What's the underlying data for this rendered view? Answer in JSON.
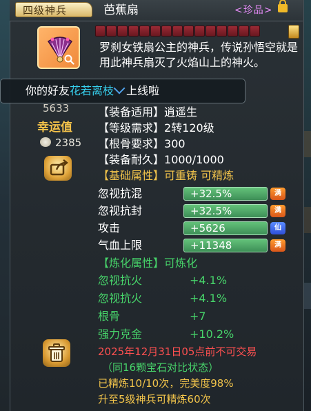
{
  "header": {
    "rank_tab": "四级神兵",
    "item_name": "芭蕉扇",
    "rarity": "<珍品>"
  },
  "description": "罗刹女铁扇公主的神兵，传说孙悟空就是用此神兵扇灭了火焰山上的神火。",
  "toast": {
    "prefix": "你的好友",
    "friend": "花若离枝",
    "suffix": "上线啦"
  },
  "left": {
    "score": "5633",
    "luck_label": "幸运值",
    "coin_value": "2385"
  },
  "base_rows": [
    {
      "label": "【装备适用】",
      "value": "逍遥生"
    },
    {
      "label": "【等级需求】",
      "value": "2转120级"
    },
    {
      "label": "【根骨要求】",
      "value": "300"
    },
    {
      "label": "【装备耐久】",
      "value": "1000/1000"
    }
  ],
  "base_attr": {
    "label": "【基础属性】",
    "value": "可重铸  可精炼"
  },
  "base_stats": [
    {
      "label": "忽视抗混",
      "value": "+32.5%",
      "badge": "满",
      "badge_color": "#e8742a"
    },
    {
      "label": "忽视抗封",
      "value": "+32.5%",
      "badge": "满",
      "badge_color": "#e8742a"
    },
    {
      "label": "攻击",
      "value": "+5626",
      "badge": "仙",
      "badge_color": "#3d62ee"
    },
    {
      "label": "气血上限",
      "value": "+11348",
      "badge": "满",
      "badge_color": "#e8742a"
    }
  ],
  "refine_attr": {
    "label": "【炼化属性】",
    "value": "可炼化"
  },
  "refine_stats": [
    {
      "label": "忽视抗火",
      "value": "+4.1%"
    },
    {
      "label": "忽视抗火",
      "value": "+4.1%"
    },
    {
      "label": "根骨",
      "value": "+7"
    },
    {
      "label": "强力克金",
      "value": "+10.2%"
    }
  ],
  "footer": {
    "trade_notice": "2025年12月31日05点前不可交易",
    "gem_notice": "（同16颗宝石对比状态）",
    "refined": "已精炼10/10次，完美度98%",
    "upgrade": "升至5级神兵可精炼60次"
  }
}
